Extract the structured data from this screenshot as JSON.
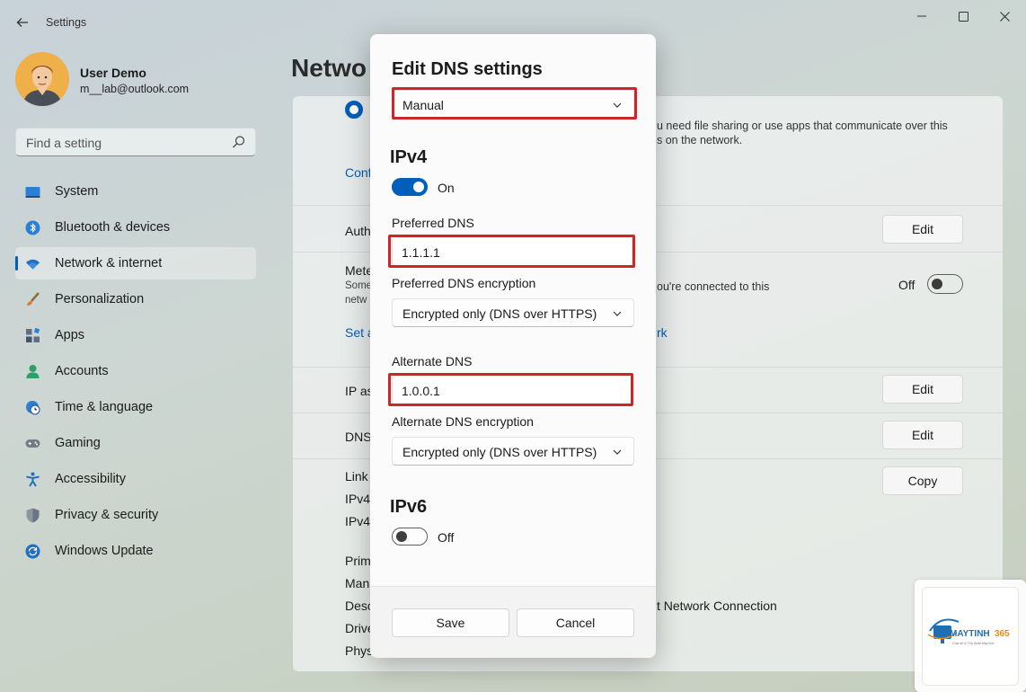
{
  "window": {
    "title": "Settings",
    "controls": [
      "minimize",
      "maximize",
      "close"
    ]
  },
  "user": {
    "name": "User Demo",
    "email": "m__lab@outlook.com"
  },
  "search": {
    "placeholder": "Find a setting"
  },
  "sidebar": {
    "items": [
      {
        "label": "System",
        "icon": "monitor-icon",
        "active": false
      },
      {
        "label": "Bluetooth & devices",
        "icon": "bluetooth-icon",
        "active": false
      },
      {
        "label": "Network & internet",
        "icon": "wifi-icon",
        "active": true
      },
      {
        "label": "Personalization",
        "icon": "brush-icon",
        "active": false
      },
      {
        "label": "Apps",
        "icon": "apps-icon",
        "active": false
      },
      {
        "label": "Accounts",
        "icon": "person-icon",
        "active": false
      },
      {
        "label": "Time & language",
        "icon": "globe-clock-icon",
        "active": false
      },
      {
        "label": "Gaming",
        "icon": "gamepad-icon",
        "active": false
      },
      {
        "label": "Accessibility",
        "icon": "accessibility-icon",
        "active": false
      },
      {
        "label": "Privacy & security",
        "icon": "shield-icon",
        "active": false
      },
      {
        "label": "Windows Update",
        "icon": "update-icon",
        "active": false
      }
    ]
  },
  "main": {
    "page_title_fragment": "Netwo",
    "bg_texts": {
      "network_desc_line1": "u need file sharing or use apps that communicate over this",
      "network_desc_line2": "s on the network.",
      "conf": "Conf",
      "auth": "Auth",
      "mete": "Mete",
      "some": "Some",
      "netw": "netw",
      "metered_desc": "ou're connected to this",
      "set_a": "Set a",
      "rk": "rk",
      "ip_as": "IP as",
      "dns": "DNS",
      "link": "Link",
      "ipv4_a": "IPv4",
      "ipv4_b": "IPv4",
      "prim": "Prim",
      "man": "Man",
      "desc": "Desc",
      "driv": "Drive",
      "phys": "Phys",
      "adapter_desc": "t Network Connection",
      "metered_toggle_label": "Off"
    },
    "buttons": {
      "edit_auth": "Edit",
      "edit_ip": "Edit",
      "edit_dns": "Edit",
      "copy": "Copy"
    }
  },
  "dialog": {
    "title": "Edit DNS settings",
    "mode_dropdown": "Manual",
    "ipv4": {
      "heading": "IPv4",
      "toggle_state": "On",
      "preferred_label": "Preferred DNS",
      "preferred_value": "1.1.1.1",
      "preferred_enc_label": "Preferred DNS encryption",
      "preferred_enc_value": "Encrypted only (DNS over HTTPS)",
      "alternate_label": "Alternate DNS",
      "alternate_value": "1.0.0.1",
      "alternate_enc_label": "Alternate DNS encryption",
      "alternate_enc_value": "Encrypted only (DNS over HTTPS)"
    },
    "ipv6": {
      "heading": "IPv6",
      "toggle_state": "Off"
    },
    "save_label": "Save",
    "cancel_label": "Cancel"
  },
  "watermark": {
    "brand": "MAYTINH365",
    "tagline": "Chia sẻ & Thủ thuật Máy tính"
  },
  "colors": {
    "accent": "#005fb8",
    "highlight": "#d0242b",
    "watermark_brand": "#1f6fb5",
    "watermark_accent": "#f08a1c"
  }
}
